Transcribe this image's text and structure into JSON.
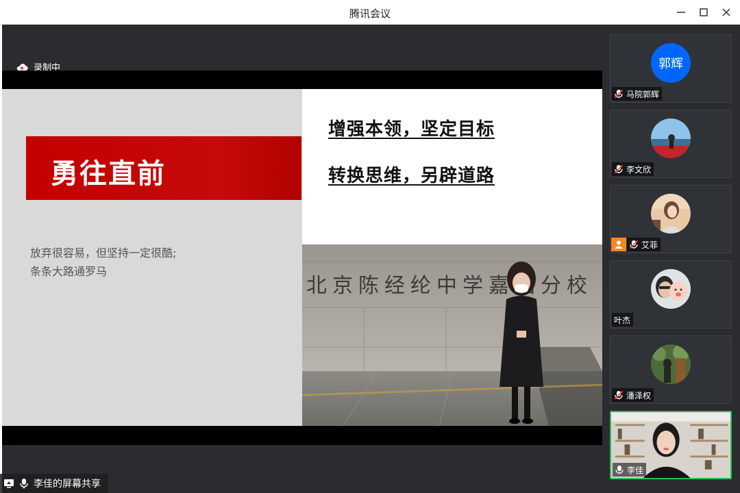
{
  "window": {
    "title": "腾讯会议",
    "minimize_icon": "minimize-icon",
    "maximize_icon": "maximize-icon",
    "close_icon": "close-icon"
  },
  "recording": {
    "label": "录制中",
    "icon": "cloud-record-icon",
    "color": "#ff4d4f"
  },
  "slide": {
    "banner_text": "勇往直前",
    "quote_line1": "放弃很容易，但坚持一定很酷;",
    "quote_line2": "条条大路通罗马",
    "headline1": "增强本领，坚定目标",
    "headline2": "转换思维，另辟道路",
    "photo_sign_text": "北京陈经纶中学嘉铭分校",
    "accent_color": "#c40000"
  },
  "screen_share": {
    "label": "李佳的屏幕共享",
    "icons": [
      "screen-share-icon",
      "microphone-icon"
    ]
  },
  "participants": [
    {
      "name": "马院郭辉",
      "avatar_text": "郭辉",
      "muted": true,
      "host": false,
      "speaking": false
    },
    {
      "name": "李文欣",
      "avatar_text": "",
      "muted": true,
      "host": false,
      "speaking": false
    },
    {
      "name": "艾菲",
      "avatar_text": "",
      "muted": true,
      "host": true,
      "speaking": false
    },
    {
      "name": "叶杰",
      "avatar_text": "",
      "muted": false,
      "host": false,
      "speaking": false
    },
    {
      "name": "潘泽权",
      "avatar_text": "",
      "muted": true,
      "host": false,
      "speaking": false
    },
    {
      "name": "李佳",
      "avatar_text": "",
      "muted": false,
      "host": false,
      "speaking": true
    }
  ],
  "colors": {
    "active_speaker_border": "#2ebd59",
    "avatar_blue": "#0066ff",
    "host_badge": "#f08a24"
  }
}
